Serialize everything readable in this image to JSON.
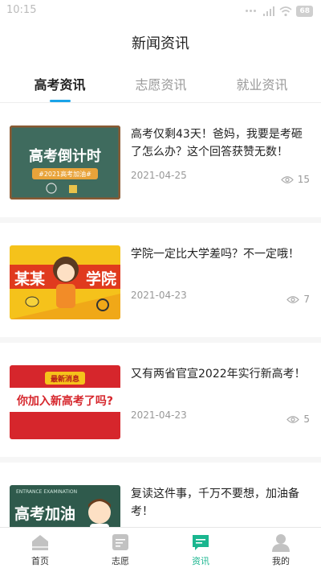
{
  "status_bar": {
    "time": "10:15",
    "battery": "68"
  },
  "header": {
    "title": "新闻资讯"
  },
  "tabs": [
    {
      "label": "高考资讯",
      "active": true
    },
    {
      "label": "志愿资讯",
      "active": false
    },
    {
      "label": "就业资讯",
      "active": false
    }
  ],
  "news": [
    {
      "title": "高考仅剩43天！爸妈，我要是考砸了怎么办？这个回答获赞无数！",
      "date": "2021-04-25",
      "views": "15",
      "thumb_text": [
        "高考倒计时",
        "#2021高考加油#"
      ]
    },
    {
      "title": "学院一定比大学差吗？不一定哦！",
      "date": "2021-04-23",
      "views": "7",
      "thumb_text": [
        "某某",
        "学院"
      ]
    },
    {
      "title": "又有两省官宣2022年实行新高考！",
      "date": "2021-04-23",
      "views": "5",
      "thumb_text": [
        "最新消息",
        "你加入新高考了吗?"
      ]
    },
    {
      "title": "复读这件事，千万不要想，加油备考！",
      "date": "",
      "views": "",
      "thumb_text": [
        "ENTRANCE EXAMINATION",
        "高考加油"
      ]
    }
  ],
  "bottom_nav": [
    {
      "label": "首页",
      "icon": "home-icon",
      "active": false
    },
    {
      "label": "志愿",
      "icon": "document-icon",
      "active": false
    },
    {
      "label": "资讯",
      "icon": "news-chat-icon",
      "active": true
    },
    {
      "label": "我的",
      "icon": "user-icon",
      "active": false
    }
  ],
  "colors": {
    "accent": "#1aa3e8",
    "nav_active": "#1ab68f",
    "text": "#222222",
    "muted": "#999999"
  }
}
